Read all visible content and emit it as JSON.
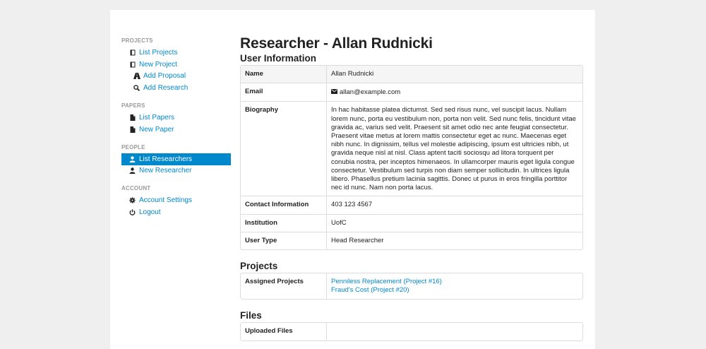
{
  "sidebar": {
    "groups": [
      {
        "header": "PROJECTS",
        "items": [
          {
            "label": "List Projects",
            "icon": "book-icon"
          },
          {
            "label": "New Project",
            "icon": "book-icon"
          },
          {
            "label": "Add Proposal",
            "icon": "road-icon"
          },
          {
            "label": "Add Research",
            "icon": "search-icon"
          }
        ]
      },
      {
        "header": "PAPERS",
        "items": [
          {
            "label": "List Papers",
            "icon": "file-icon"
          },
          {
            "label": "New Paper",
            "icon": "file-icon"
          }
        ]
      },
      {
        "header": "PEOPLE",
        "items": [
          {
            "label": "List Researchers",
            "icon": "user-icon",
            "active": true
          },
          {
            "label": "New Researcher",
            "icon": "user-icon"
          }
        ]
      },
      {
        "header": "ACCOUNT",
        "items": [
          {
            "label": "Account Settings",
            "icon": "cog-icon"
          },
          {
            "label": "Logout",
            "icon": "power-icon"
          }
        ]
      }
    ]
  },
  "main": {
    "title": "Researcher - Allan Rudnicki",
    "user_info": {
      "heading": "User Information",
      "name_label": "Name",
      "name": "Allan Rudnicki",
      "email_label": "Email",
      "email": "allan@example.com",
      "bio_label": "Biography",
      "bio": "In hac habitasse platea dictumst. Sed sed risus nunc, vel suscipit lacus. Nullam lorem nunc, porta eu vestibulum non, porta non velit. Sed nunc felis, tincidunt vitae gravida ac, varius sed velit. Praesent sit amet odio nec ante feugiat consectetur. Praesent vitae metus at lorem mattis consectetur eget ac nunc. Maecenas eget nibh nunc. In dignissim, tellus vel molestie adipiscing, ipsum est ultricies nibh, ut gravida neque nisl at nisl. Class aptent taciti sociosqu ad litora torquent per conubia nostra, per inceptos himenaeos. In ullamcorper mauris eget ligula congue consectetur. Vestibulum sed turpis non diam semper sollicitudin. In ultrices ligula libero. Phasellus pretium lacinia sagittis. Donec ut purus in eros fringilla porttitor nec id nunc. Nam non porta lacus.",
      "contact_label": "Contact Information",
      "contact": "403 123 4567",
      "institution_label": "Institution",
      "institution": "UofC",
      "type_label": "User Type",
      "type": "Head Researcher"
    },
    "projects": {
      "heading": "Projects",
      "assigned_label": "Assigned Projects",
      "items": [
        "Penniless Replacement (Project #16)",
        "Fraud's Cost (Project #20)"
      ]
    },
    "files": {
      "heading": "Files",
      "uploaded_label": "Uploaded Files"
    }
  }
}
